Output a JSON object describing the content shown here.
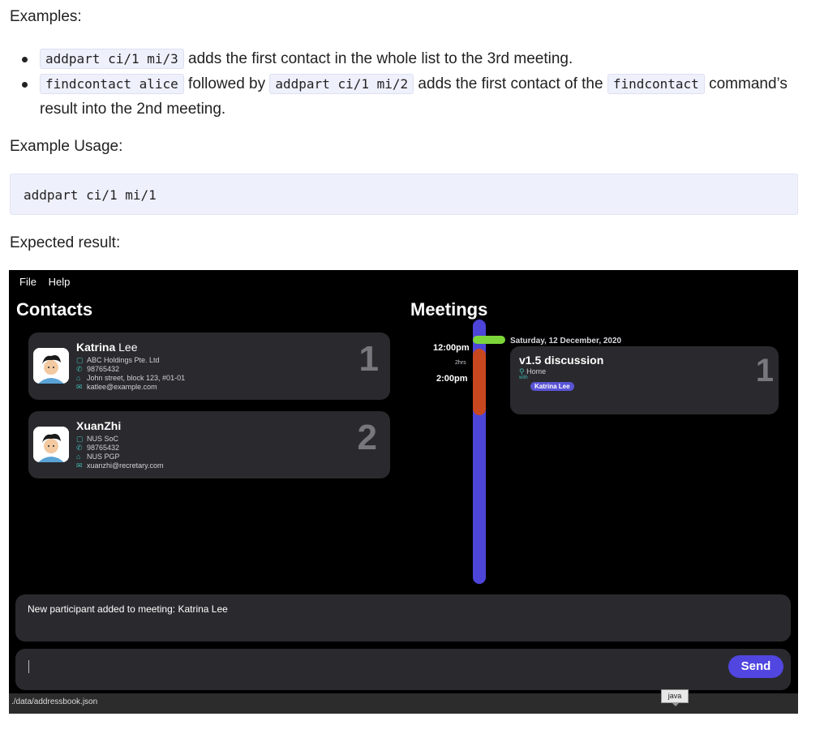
{
  "doc": {
    "examples_heading": "Examples:",
    "bullets": [
      {
        "code1": "addpart ci/1 mi/3",
        "text1": " adds the first contact in the whole list to the 3rd meeting."
      },
      {
        "code1": "findcontact alice",
        "text1": " followed by ",
        "code2": "addpart ci/1 mi/2",
        "text2": " adds the first contact of the ",
        "code3": "findcontact",
        "text3": " command’s result into the 2nd meeting."
      }
    ],
    "usage_heading": "Example Usage:",
    "usage_code": "addpart ci/1 mi/1",
    "result_heading": "Expected result:"
  },
  "app": {
    "menu": [
      "File",
      "Help"
    ],
    "contacts_title": "Contacts",
    "meetings_title": "Meetings",
    "contacts": [
      {
        "first": "Katrina",
        "last": " Lee",
        "company": "ABC Holdings Pte. Ltd",
        "phone": "98765432",
        "address": "John street, block 123, #01-01",
        "email": "katlee@example.com",
        "index": "1"
      },
      {
        "first": "XuanZhi",
        "last": "",
        "company": "NUS SoC",
        "phone": "98765432",
        "address": "NUS PGP",
        "email": "xuanzhi@recretary.com",
        "index": "2"
      }
    ],
    "timeline": {
      "start": "12:00pm",
      "duration": "2hrs",
      "end": "2:00pm",
      "date": "Saturday, 12 December, 2020"
    },
    "meeting": {
      "title": "v1.5 discussion",
      "location": "Home",
      "with_label": "with",
      "participant": "Katrina Lee",
      "index": "1"
    },
    "result_text": "New participant added to meeting: Katrina Lee",
    "send_label": "Send",
    "status_path": "./data/addressbook.json",
    "tooltip": "java",
    "colors": {
      "accent": "#5146e0",
      "timeline": "#4d45d8",
      "meeting_block": "#c8471f",
      "date_marker": "#7cd63a"
    }
  }
}
